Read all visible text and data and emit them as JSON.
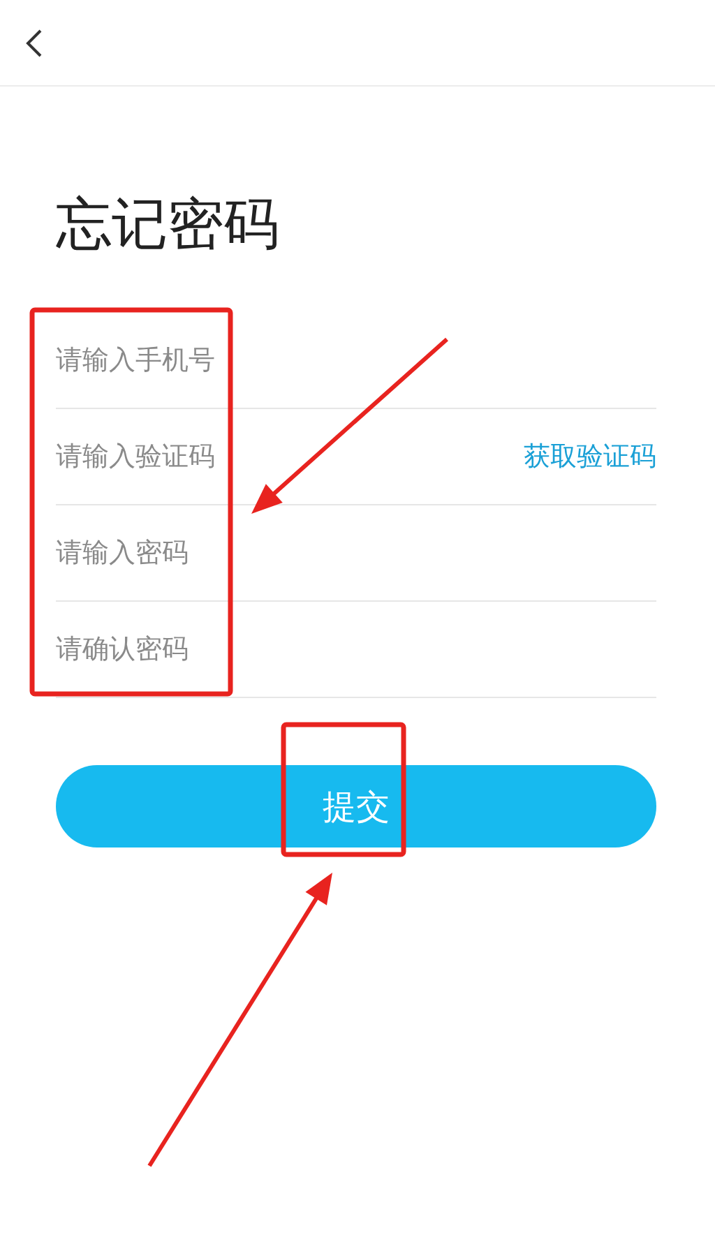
{
  "title": "忘记密码",
  "fields": [
    {
      "placeholder": "请输入手机号"
    },
    {
      "placeholder": "请输入验证码",
      "action": "获取验证码"
    },
    {
      "placeholder": "请输入密码"
    },
    {
      "placeholder": "请确认密码"
    }
  ],
  "submit": "提交",
  "annotations": [
    {
      "kind": "box"
    },
    {
      "kind": "arrow"
    },
    {
      "kind": "box"
    },
    {
      "kind": "arrow"
    }
  ]
}
